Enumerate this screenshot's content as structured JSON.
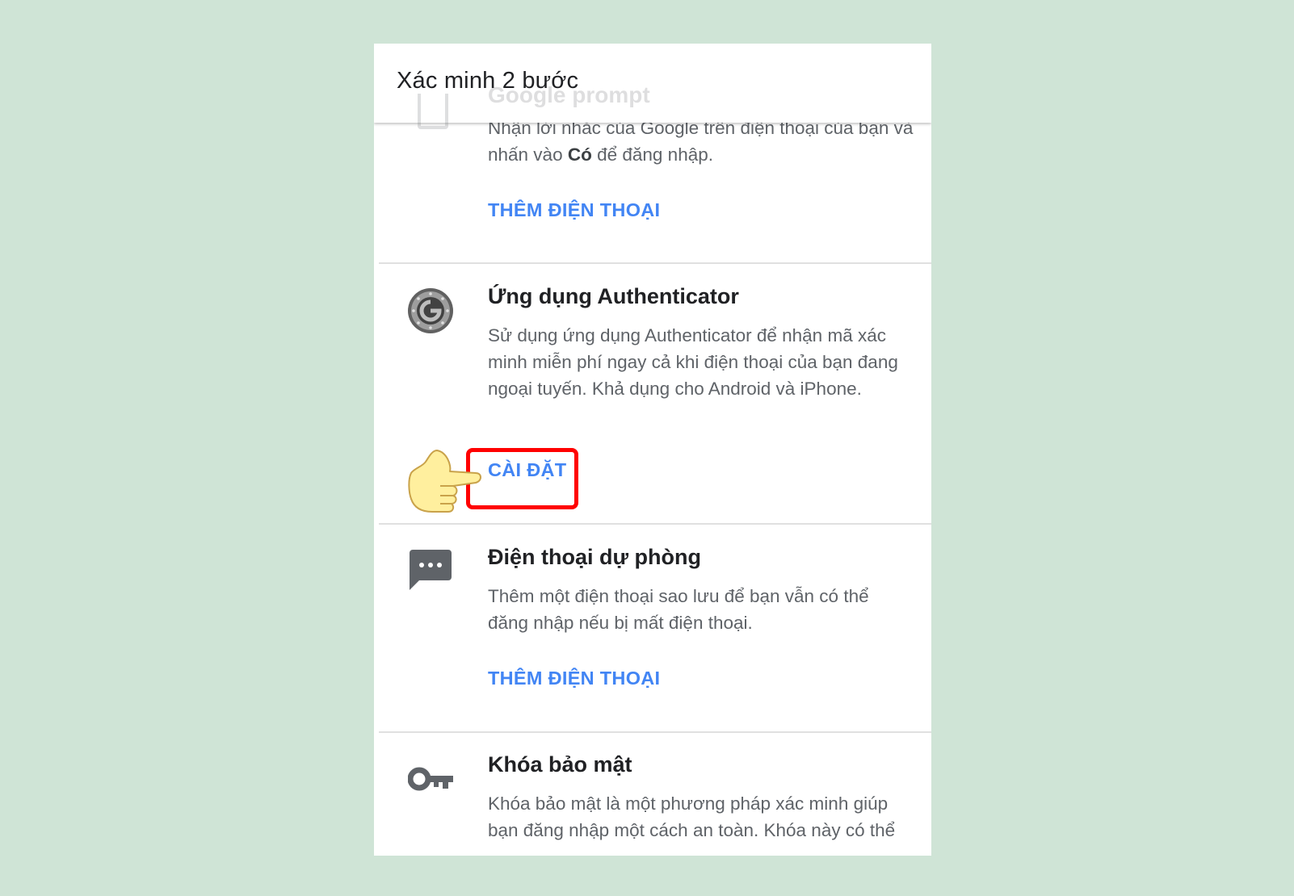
{
  "appbar": {
    "title": "Xác minh 2 bước"
  },
  "google_prompt": {
    "title": "Google prompt",
    "description_part1": "Nhận lời nhắc của Google trên điện thoại của bạn và nhấn vào ",
    "description_bold": "Có",
    "description_part2": " để đăng nhập.",
    "button": "THÊM ĐIỆN THOẠI",
    "icon": "phone-icon"
  },
  "authenticator": {
    "title": "Ứng dụng Authenticator",
    "description": "Sử dụng ứng dụng Authenticator để nhận mã xác minh miễn phí ngay cả khi điện thoại của bạn đang ngoại tuyến. Khả dụng cho Android và iPhone.",
    "button": "CÀI ĐẶT",
    "icon": "google-authenticator-icon"
  },
  "backup_phone": {
    "title": "Điện thoại dự phòng",
    "description": "Thêm một điện thoại sao lưu để bạn vẫn có thể đăng nhập nếu bị mất điện thoại.",
    "button": "THÊM ĐIỆN THOẠI",
    "icon": "message-icon"
  },
  "security_key": {
    "title": "Khóa bảo mật",
    "description": "Khóa bảo mật là một phương pháp xác minh giúp bạn đăng nhập một cách an toàn. Khóa này có thể",
    "icon": "key-icon"
  },
  "annotation": {
    "pointer": "pointing-hand-icon",
    "highlight_color": "#ff0000"
  },
  "colors": {
    "background": "#cfe4d6",
    "link": "#4285f4",
    "title": "#202124",
    "body_text": "#5f6368"
  }
}
